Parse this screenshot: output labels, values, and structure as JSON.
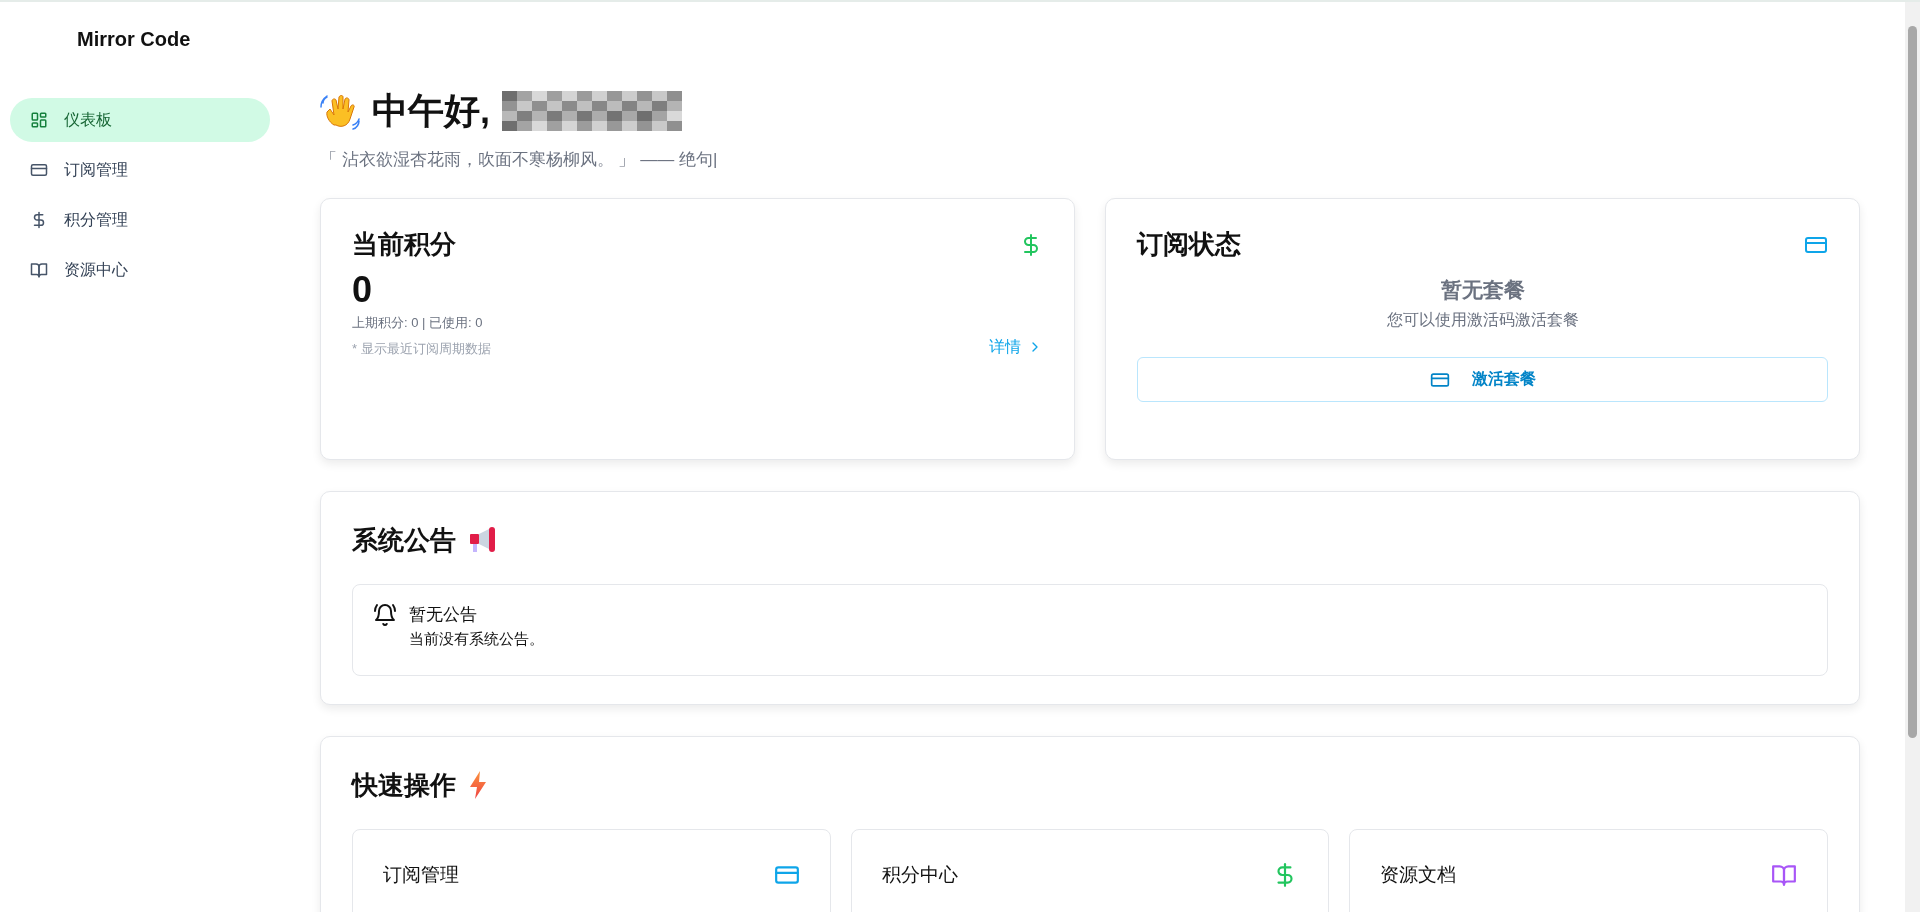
{
  "app": {
    "title": "Mirror Code"
  },
  "sidebar": {
    "items": [
      {
        "label": "仪表板",
        "selected": true
      },
      {
        "label": "订阅管理",
        "selected": false
      },
      {
        "label": "积分管理",
        "selected": false
      },
      {
        "label": "资源中心",
        "selected": false
      }
    ]
  },
  "greeting": {
    "text": "中午好,"
  },
  "quote": "「 沾衣欲湿杏花雨，吹面不寒杨柳风。 」 —— 绝句|",
  "points_card": {
    "title": "当前积分",
    "value": "0",
    "summary": "上期积分: 0 | 已使用: 0",
    "note": "* 显示最近订阅周期数据",
    "link": "详情"
  },
  "subscription_card": {
    "title": "订阅状态",
    "empty_title": "暂无套餐",
    "empty_text": "您可以使用激活码激活套餐",
    "button": "激活套餐"
  },
  "announcements": {
    "title": "系统公告",
    "items": [
      {
        "title": "暂无公告",
        "text": "当前没有系统公告。"
      }
    ]
  },
  "quick_actions": {
    "title": "快速操作",
    "items": [
      {
        "label": "订阅管理",
        "color": "#0ea5e9"
      },
      {
        "label": "积分中心",
        "color": "#22c55e"
      },
      {
        "label": "资源文档",
        "color": "#a855f7"
      }
    ]
  }
}
